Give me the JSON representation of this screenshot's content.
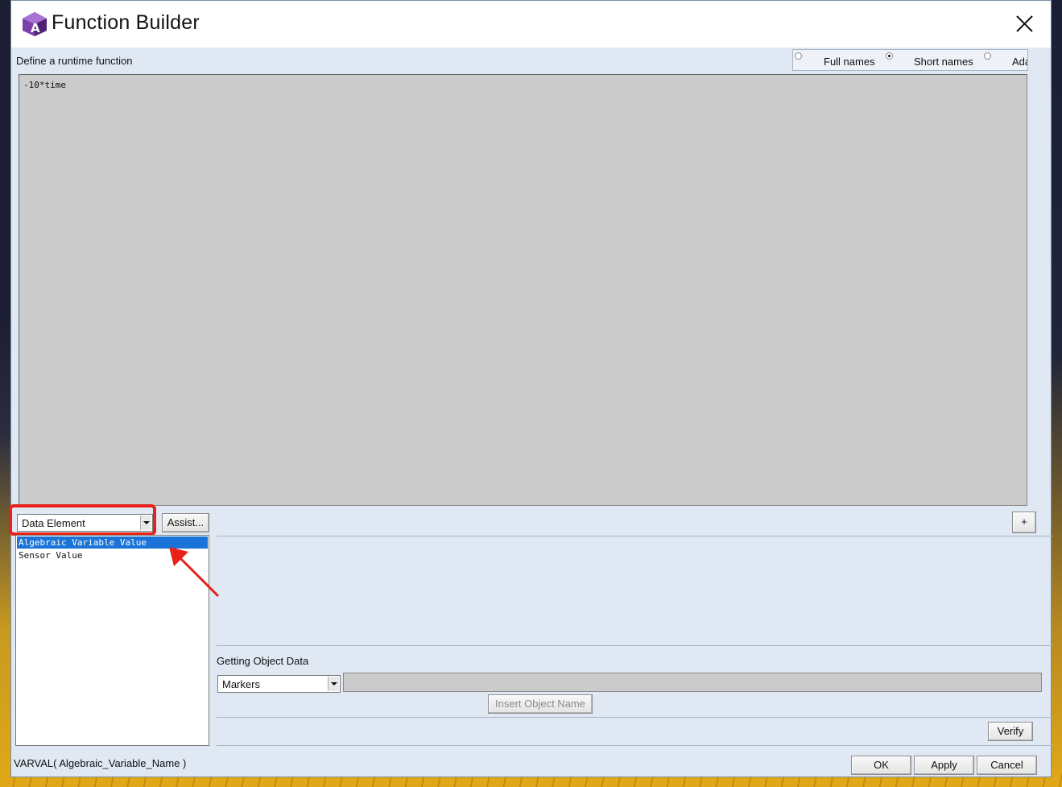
{
  "window": {
    "title": "Function Builder"
  },
  "editor": {
    "label": "Define a runtime function",
    "content": "-10*time"
  },
  "name_display": {
    "options": [
      {
        "label": "Full names",
        "checked": false
      },
      {
        "label": "Short names",
        "checked": true
      },
      {
        "label": "Ada",
        "checked": false
      }
    ]
  },
  "category": {
    "selected": "Data Element",
    "assist_label": "Assist...",
    "plus_label": "+"
  },
  "functions_list": {
    "items": [
      {
        "label": "Algebraic Variable Value",
        "selected": true
      },
      {
        "label": "Sensor Value",
        "selected": false
      }
    ],
    "signature": "VARVAL( Algebraic_Variable_Name )"
  },
  "object_data": {
    "heading": "Getting Object Data",
    "type_selected": "Markers",
    "insert_label": "Insert Object Name"
  },
  "actions": {
    "verify": "Verify",
    "ok": "OK",
    "apply": "Apply",
    "cancel": "Cancel"
  },
  "colors": {
    "selection": "#1a73d6",
    "annotation": "#e8211a",
    "dialog_bg": "#dfe8f3"
  }
}
